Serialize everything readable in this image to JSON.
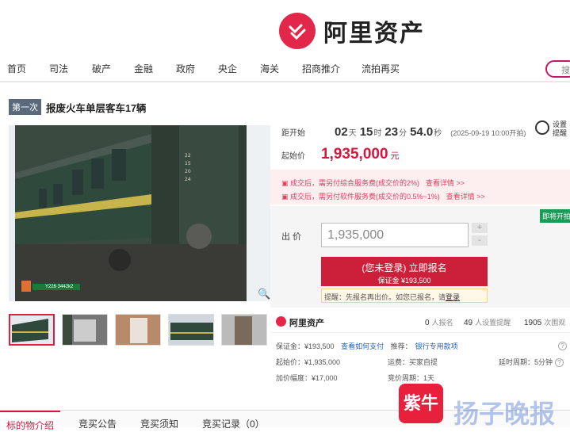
{
  "brand": {
    "name": "阿里资产",
    "color": "#e3274a"
  },
  "nav": [
    "首页",
    "司法",
    "破产",
    "金融",
    "政府",
    "央企",
    "海关",
    "招商推介",
    "流拍再买"
  ],
  "search": {
    "glyph": "搜"
  },
  "lot": {
    "round": "第一次",
    "title": "报废火车单层客车17辆"
  },
  "photo": {
    "caption": "Y226 3442k2",
    "zoom_icon": "magnifier-icon"
  },
  "countdown": {
    "label": "距开始",
    "days": "02",
    "days_unit": "天",
    "hours": "15",
    "hours_unit": "时",
    "minutes": "23",
    "minutes_unit": "分",
    "seconds": "54.0",
    "seconds_unit": "秒",
    "start_note": "(2025-09-19 10:00开拍)"
  },
  "remind": {
    "line1": "设置",
    "line2": "提醒"
  },
  "start_price": {
    "label": "起始价",
    "value": "1,935,000",
    "unit": "元"
  },
  "fees": [
    {
      "text": "成交后，需另付综合服务费(成交价的2%)",
      "link": "查看详情 >>"
    },
    {
      "text": "成交后，需另付软件服务费(成交价的0.5%~1%)",
      "link": "查看详情 >>"
    }
  ],
  "soon_badge": "即将开拍",
  "bid": {
    "label": "出 价",
    "value": "1,935,000",
    "plus": "+",
    "minus": "-",
    "button_main": "(您未登录) 立即报名",
    "button_sub": "保证金 ¥193,500",
    "hint_prefix": "提醒：先报名再出价。如您已报名，请",
    "hint_link": "登录"
  },
  "stats": {
    "brand": "阿里资产",
    "signup": "0",
    "signup_label": "人报名",
    "reminders": "49",
    "reminders_label": "人设置提醒",
    "views": "1905",
    "views_label": "次围观"
  },
  "details": {
    "deposit": "保证金：¥193,500",
    "how_to_pay": "查看如何支付",
    "recommend_label": "推荐：",
    "recommend_link": "银行专用款项",
    "start_price": "起始价：¥1,935,000",
    "shipping": "运费：买家自提",
    "delay": "延时周期：5分钟",
    "increment": "加价幅度：¥17,000",
    "cycle": "竞价周期：1天"
  },
  "tabs": [
    "标的物介绍",
    "竞买公告",
    "竞买须知",
    "竞买记录（0）"
  ],
  "watermark": {
    "logo": "紫牛",
    "text": "扬子晚报"
  }
}
